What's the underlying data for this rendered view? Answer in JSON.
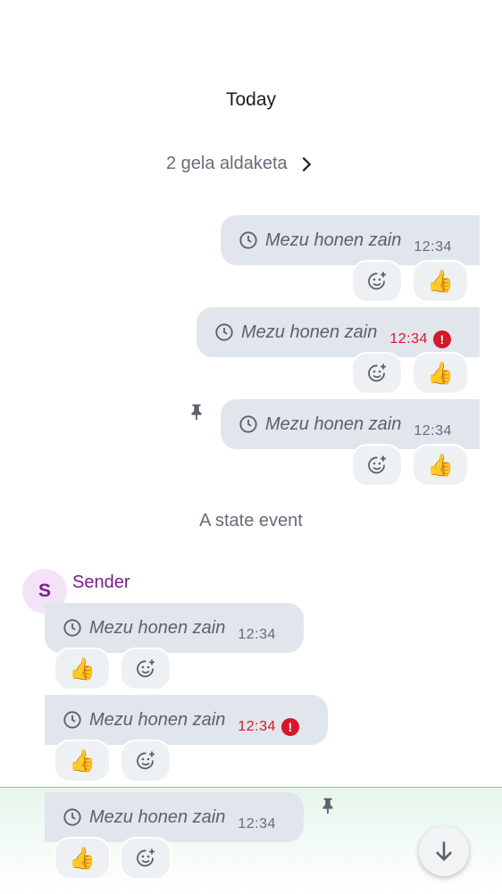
{
  "timeline": {
    "day_divider": "Today",
    "group_changes": "2 gela aldaketa",
    "state_event": "A state event"
  },
  "sender": {
    "name": "Sender",
    "avatar_letter": "S"
  },
  "outgoing": [
    {
      "text": "Mezu honen zain",
      "time": "12:34",
      "error": false,
      "pinned": false,
      "reaction": "👍"
    },
    {
      "text": "Mezu honen zain",
      "time": "12:34",
      "error": true,
      "pinned": false,
      "reaction": "👍"
    },
    {
      "text": "Mezu honen zain",
      "time": "12:34",
      "error": false,
      "pinned": true,
      "reaction": "👍"
    }
  ],
  "incoming": [
    {
      "text": "Mezu honen zain",
      "time": "12:34",
      "error": false,
      "pinned": false,
      "reaction": "👍"
    },
    {
      "text": "Mezu honen zain",
      "time": "12:34",
      "error": true,
      "pinned": false,
      "reaction": "👍"
    },
    {
      "text": "Mezu honen zain",
      "time": "12:34",
      "error": false,
      "pinned": true,
      "reaction": "👍",
      "highlighted": true
    }
  ],
  "icons": {
    "clock": "clock-icon",
    "add_reaction": "add-reaction-icon",
    "pin": "pin-icon",
    "error": "error-icon",
    "chevron": "chevron-right-icon",
    "scroll_down": "arrow-down-icon"
  },
  "error_glyph": "!",
  "colors": {
    "bubble": "#e1e6ec",
    "error": "#d51928",
    "sender": "#7a1e8c",
    "highlight": "#e6f6ec"
  }
}
